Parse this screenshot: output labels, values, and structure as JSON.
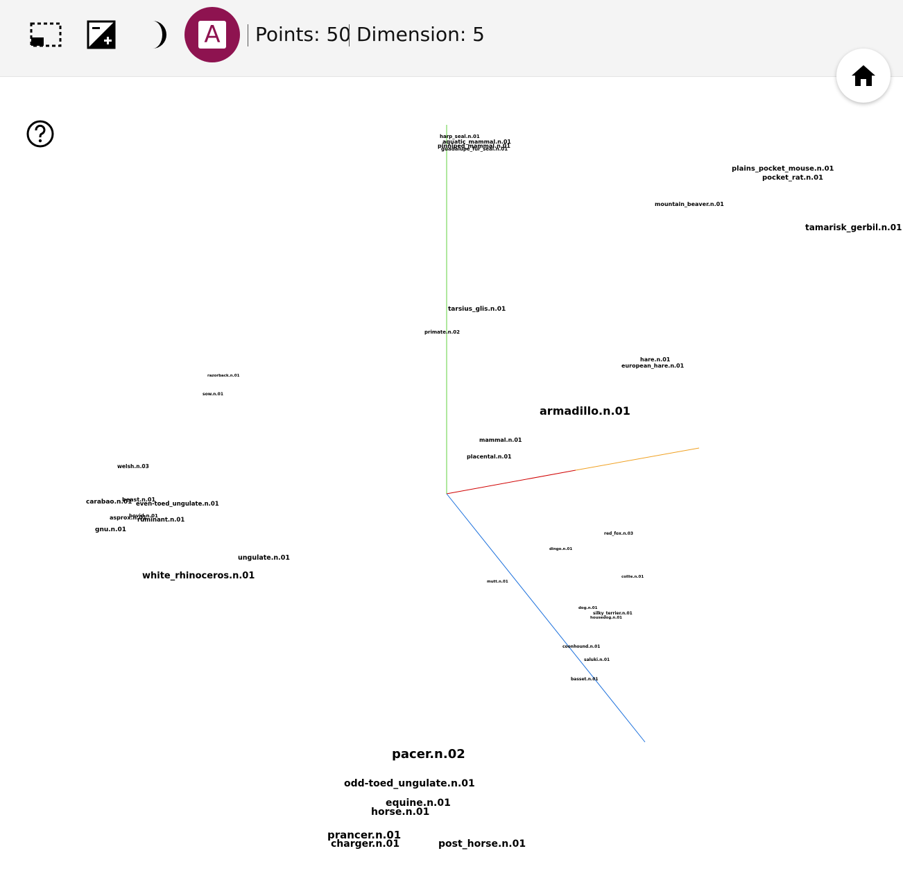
{
  "toolbar": {
    "buttons": [
      {
        "name": "select-region-button",
        "icon": "selection-rectangle-icon"
      },
      {
        "name": "contrast-button",
        "icon": "exposure-icon"
      },
      {
        "name": "night-mode-button",
        "icon": "moon-icon"
      }
    ],
    "label_mode": {
      "letter": "A",
      "icon": "text-label-icon",
      "color": "#8e1350"
    },
    "points_text": "Points: 50",
    "dimension_text": "Dimension: 5",
    "home_icon": "home-icon"
  },
  "help": {
    "icon": "help-circle-icon"
  },
  "axes": {
    "colors": [
      "#00c000",
      "#d00000",
      "#f0a020",
      "#1a6fdc"
    ]
  },
  "points": [
    {
      "label": "harp_seal.n.01"
    },
    {
      "label": "aquatic_mammal.n.01"
    },
    {
      "label": "pinniped_mammal.n.01"
    },
    {
      "label": "guadalupe_fur_seal.n.01"
    },
    {
      "label": "plains_pocket_mouse.n.01"
    },
    {
      "label": "pocket_rat.n.01"
    },
    {
      "label": "mountain_beaver.n.01"
    },
    {
      "label": "tamarisk_gerbil.n.01"
    },
    {
      "label": "tarsius_glis.n.01"
    },
    {
      "label": "primate.n.02"
    },
    {
      "label": "hare.n.01"
    },
    {
      "label": "european_hare.n.01"
    },
    {
      "label": "razorback.n.01"
    },
    {
      "label": "sow.n.01"
    },
    {
      "label": "armadillo.n.01"
    },
    {
      "label": "mammal.n.01"
    },
    {
      "label": "placental.n.01"
    },
    {
      "label": "welsh.n.03"
    },
    {
      "label": "beast.n.01"
    },
    {
      "label": "carabao.n.01"
    },
    {
      "label": "even-toed_ungulate.n.01"
    },
    {
      "label": "asprox.n.01"
    },
    {
      "label": "bovid.n.01"
    },
    {
      "label": "ruminant.n.01"
    },
    {
      "label": "gnu.n.01"
    },
    {
      "label": "ungulate.n.01"
    },
    {
      "label": "white_rhinoceros.n.01"
    },
    {
      "label": "red_fox.n.03"
    },
    {
      "label": "dingo.n.01"
    },
    {
      "label": "mutt.n.01"
    },
    {
      "label": "collie.n.01"
    },
    {
      "label": "dog.n.01"
    },
    {
      "label": "silky_terrier.n.01"
    },
    {
      "label": "housedog.n.01"
    },
    {
      "label": "coonhound.n.01"
    },
    {
      "label": "saluki.n.01"
    },
    {
      "label": "basset.n.01"
    },
    {
      "label": "pacer.n.02"
    },
    {
      "label": "odd-toed_ungulate.n.01"
    },
    {
      "label": "equine.n.01"
    },
    {
      "label": "horse.n.01"
    },
    {
      "label": "prancer.n.01"
    },
    {
      "label": "charger.n.01"
    },
    {
      "label": "post_horse.n.01"
    }
  ]
}
